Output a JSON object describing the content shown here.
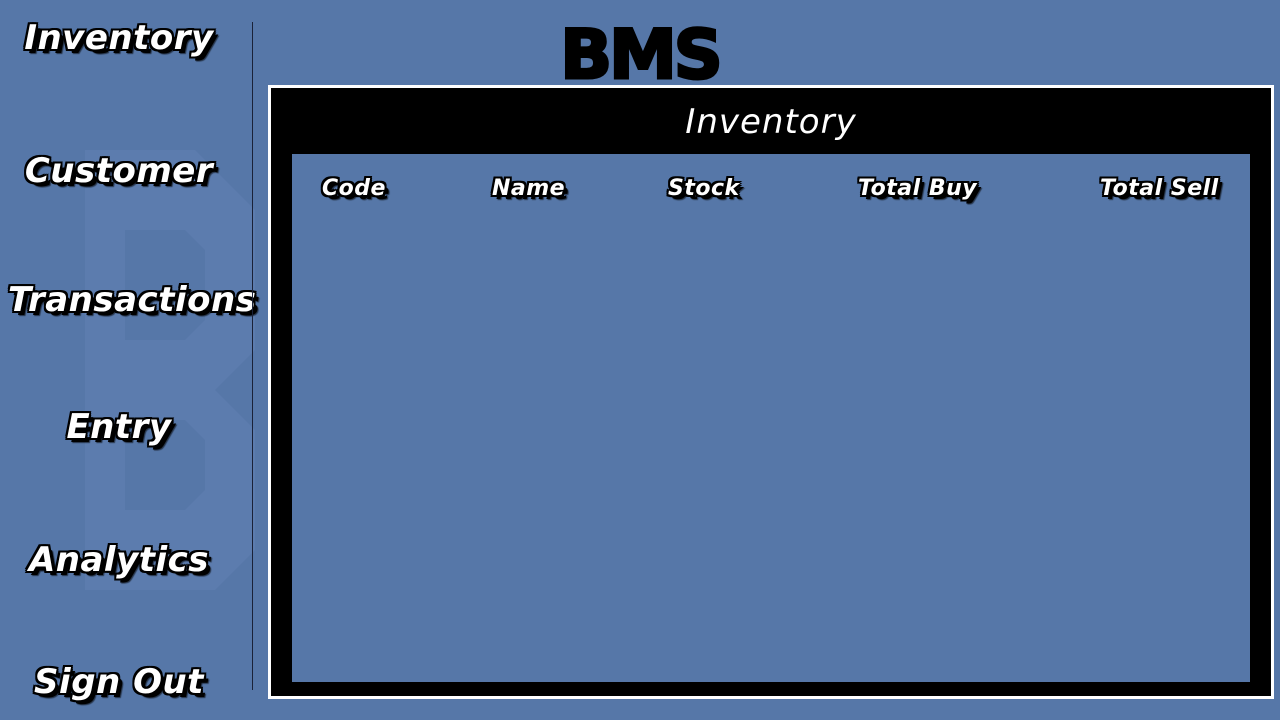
{
  "sidebar": {
    "items": [
      {
        "label": "Inventory"
      },
      {
        "label": "Customer"
      },
      {
        "label": "Transactions"
      },
      {
        "label": "Entry"
      },
      {
        "label": "Analytics"
      },
      {
        "label": "Sign Out"
      }
    ]
  },
  "header": {
    "logo_text": "BMS"
  },
  "panel": {
    "title": "Inventory",
    "columns": [
      "Code",
      "Name",
      "Stock",
      "Total Buy",
      "Total Sell"
    ],
    "rows": []
  },
  "colors": {
    "background": "#5677a8",
    "panel": "#000000",
    "text": "#ffffff"
  }
}
